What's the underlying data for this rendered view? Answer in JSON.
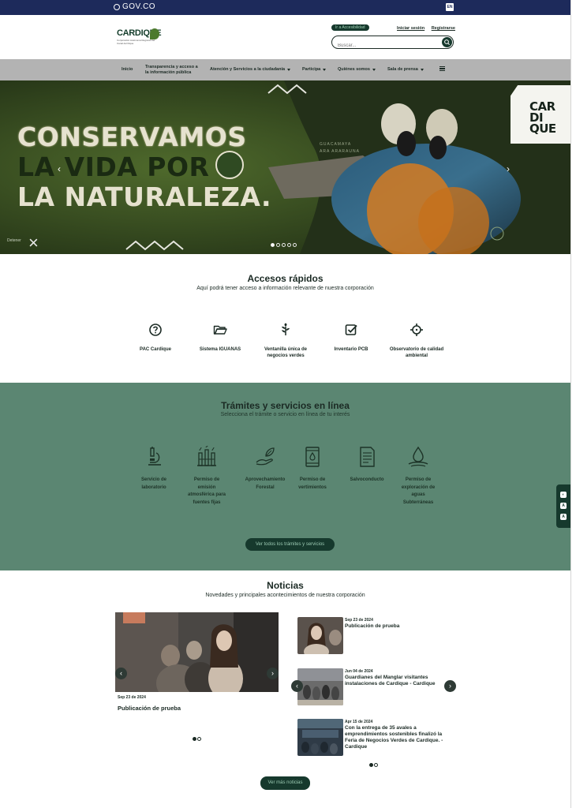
{
  "gov_bar": {
    "brand": "GOV.CO",
    "lang": "EN"
  },
  "header": {
    "logo_text": "CARDIQUE",
    "logo_subtitle": "Corporación Autónoma Regional del Canal del Dique",
    "pill_text": "Ir a Accesibilidad",
    "login_label": "Iniciar sesión",
    "register_label": "Registrarse",
    "search_placeholder": "Buscar..."
  },
  "nav": {
    "items": [
      {
        "label": "Inicio",
        "has_caret": false
      },
      {
        "label": "Transparencia y acceso a la información pública",
        "has_caret": false
      },
      {
        "label": "Atención y Servicios a la ciudadanía",
        "has_caret": true
      },
      {
        "label": "Participa",
        "has_caret": true
      },
      {
        "label": "Quiénes somos",
        "has_caret": true
      },
      {
        "label": "Sala de prensa",
        "has_caret": true
      }
    ]
  },
  "hero": {
    "line1": "CONSERVAMOS",
    "line2": "LA VIDA POR",
    "line3": "LA NATURALEZA.",
    "caption_line1": "GUACAMAYA",
    "caption_line2": "ARA ARARAUNA",
    "badge_text": "CAR DI QUE",
    "pause_label": "Detener",
    "slide_count": 5,
    "active_slide": 1
  },
  "accesos": {
    "title": "Accesos rápidos",
    "subtitle": "Aquí podrá tener acceso a información relevante de nuestra corporación",
    "items": [
      {
        "label": "PAC Cardique",
        "icon": "question-circle-icon"
      },
      {
        "label": "Sistema IGUANAS",
        "icon": "folder-open-icon"
      },
      {
        "label": "Ventanilla única de negocios verdes",
        "icon": "leaf-plant-icon"
      },
      {
        "label": "Inventario PCB",
        "icon": "checkbox-icon"
      },
      {
        "label": "Observatorio de calidad ambiental",
        "icon": "crosshair-icon"
      }
    ]
  },
  "tramites": {
    "title": "Trámites y servicios en línea",
    "subtitle": "Selecciona el trámite o servicio en línea de tu interés",
    "items": [
      {
        "label": "Servicio de laboratorio",
        "icon": "microscope-icon"
      },
      {
        "label": "Permiso de emisión atmosférica para fuentes fijas",
        "icon": "factory-icon"
      },
      {
        "label": "Aprovechamiento Forestal",
        "icon": "hand-leaf-icon"
      },
      {
        "label": "Permiso de vertimientos",
        "icon": "barrel-drop-icon"
      },
      {
        "label": "Salvoconducto",
        "icon": "document-icon"
      },
      {
        "label": "Permiso de exploración de aguas Subterráneas",
        "icon": "water-drop-icon"
      }
    ],
    "button_label": "Ver todos los trámites y servicios"
  },
  "noticias": {
    "title": "Noticias",
    "subtitle": "Novedades y principales acontecimientos de nuestra corporación",
    "featured": {
      "date": "Sep 23 de 2024",
      "title": "Publicación de prueba"
    },
    "list": [
      {
        "date": "Sep 23 de 2024",
        "title": "Publicación de prueba"
      },
      {
        "date": "Jun 04 de 2024",
        "title": "Guardianes del Manglar visitantes instalaciones de Cardique - Cardique"
      },
      {
        "date": "Apr 15 de 2024",
        "title": "Con la entrega de 35 avales a emprendimientos sostenibles finalizó la Feria de Negocios Verdes de Cardique. - Cardique"
      }
    ],
    "button_label": "Ver más noticias"
  },
  "colors": {
    "gov_blue": "#1d2a5b",
    "brand_dark_green": "#16392d",
    "tramites_bg": "#5b8672",
    "nav_grey": "#b3b3b3"
  }
}
